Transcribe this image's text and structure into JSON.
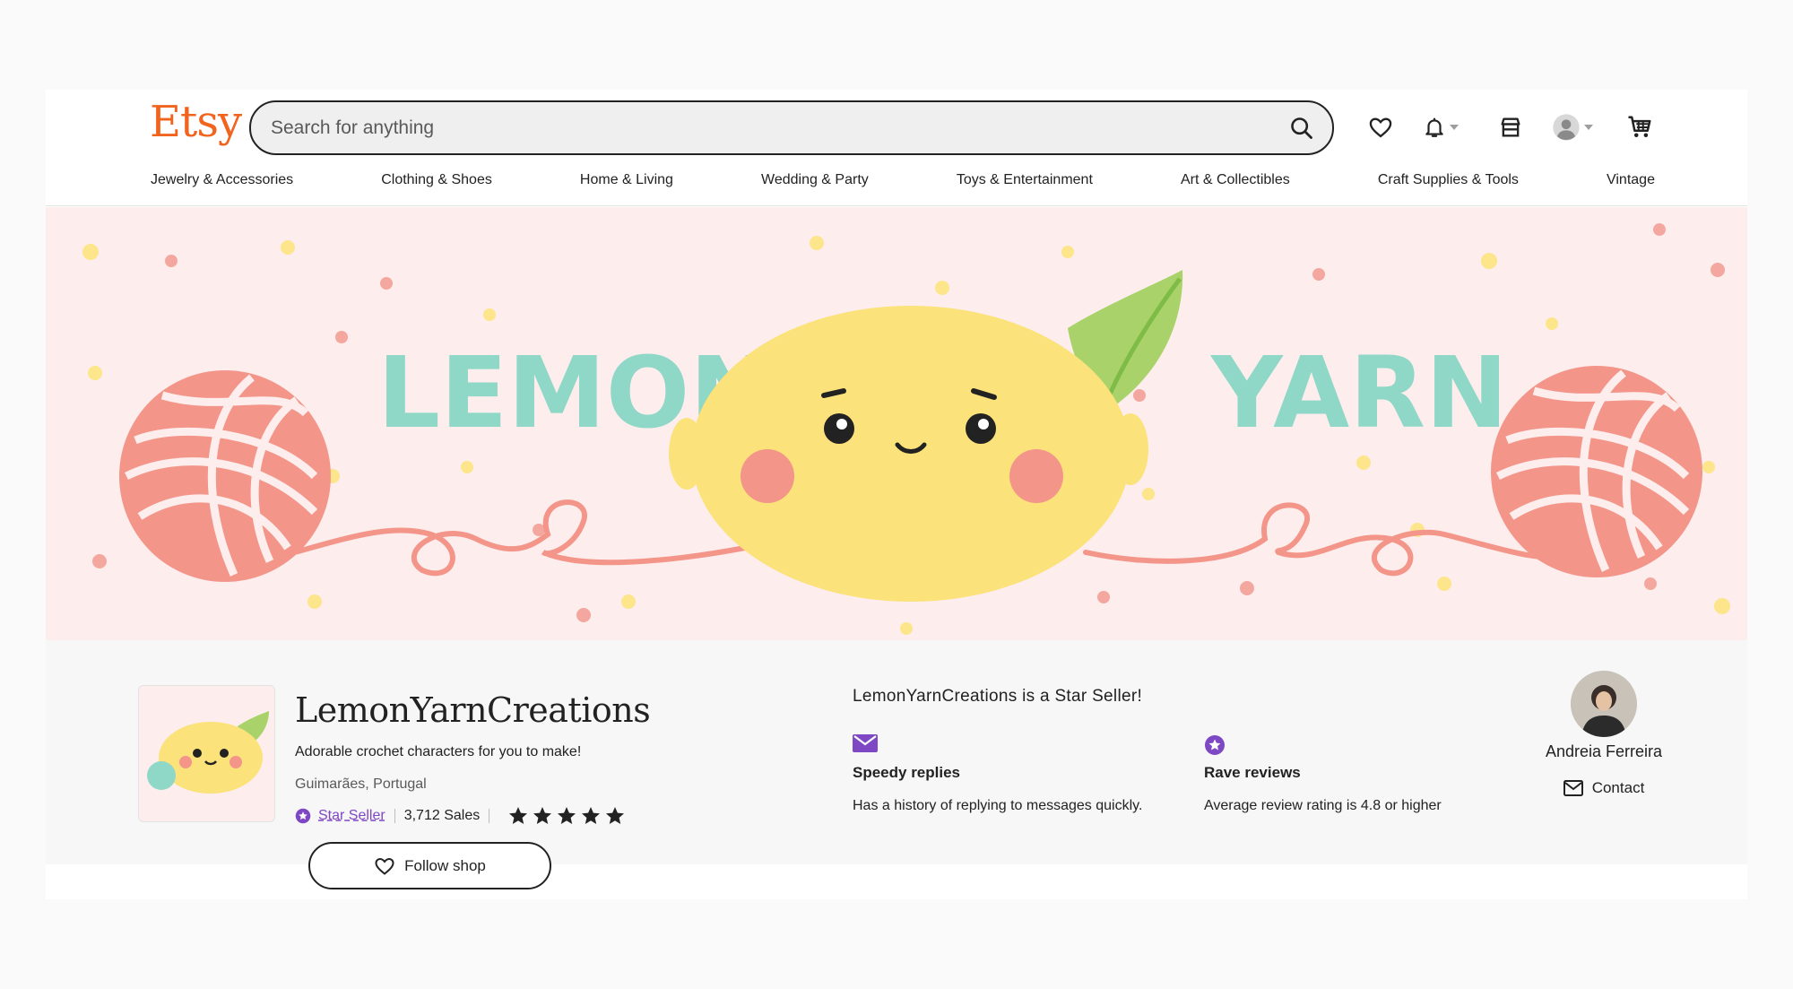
{
  "header": {
    "logo": "Etsy",
    "search_placeholder": "Search for anything",
    "icons": [
      "heart-icon",
      "bell-icon",
      "shop-manager-icon",
      "account-icon",
      "cart-icon"
    ]
  },
  "categories": [
    "Jewelry & Accessories",
    "Clothing & Shoes",
    "Home & Living",
    "Wedding & Party",
    "Toys & Entertainment",
    "Art & Collectibles",
    "Craft Supplies & Tools",
    "Vintage"
  ],
  "banner": {
    "left_word": "LEMON",
    "right_word": "YARN"
  },
  "shop": {
    "name": "LemonYarnCreations",
    "tagline": "Adorable crochet characters for you to make!",
    "location": "Guimarães, Portugal",
    "star_seller_label": "Star Seller",
    "sales": "3,712 Sales",
    "rating_stars": 5,
    "follow_label": "Follow shop"
  },
  "star_seller": {
    "title": "LemonYarnCreations is a Star Seller!",
    "features": [
      {
        "icon": "envelope-icon",
        "title": "Speedy replies",
        "description": "Has a history of replying to messages quickly."
      },
      {
        "icon": "star-badge-icon",
        "title": "Rave reviews",
        "description": "Average review rating is 4.8 or higher"
      }
    ]
  },
  "owner": {
    "name": "Andreia Ferreira",
    "contact_label": "Contact"
  },
  "colors": {
    "brand": "#f1641e",
    "banner_bg": "#fdeeed",
    "banner_text": "#8fd7c6",
    "yarn": "#f4958a",
    "lemon": "#fbe27a",
    "star_seller": "#7e48c4"
  }
}
